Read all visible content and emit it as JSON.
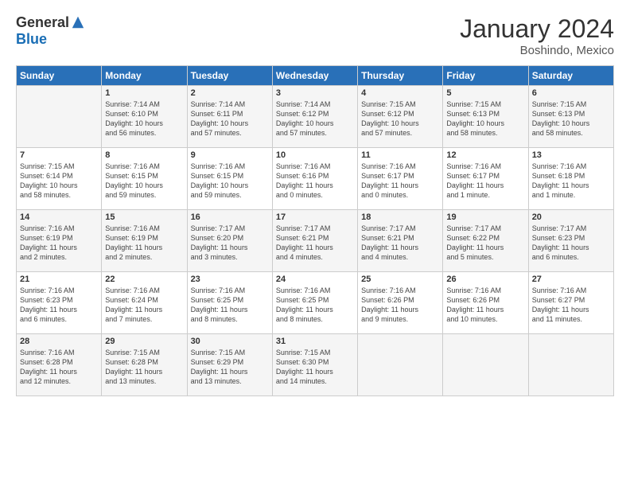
{
  "header": {
    "logo_general": "General",
    "logo_blue": "Blue",
    "title": "January 2024",
    "location": "Boshindo, Mexico"
  },
  "days_of_week": [
    "Sunday",
    "Monday",
    "Tuesday",
    "Wednesday",
    "Thursday",
    "Friday",
    "Saturday"
  ],
  "weeks": [
    [
      {
        "day": "",
        "info": ""
      },
      {
        "day": "1",
        "info": "Sunrise: 7:14 AM\nSunset: 6:10 PM\nDaylight: 10 hours\nand 56 minutes."
      },
      {
        "day": "2",
        "info": "Sunrise: 7:14 AM\nSunset: 6:11 PM\nDaylight: 10 hours\nand 57 minutes."
      },
      {
        "day": "3",
        "info": "Sunrise: 7:14 AM\nSunset: 6:12 PM\nDaylight: 10 hours\nand 57 minutes."
      },
      {
        "day": "4",
        "info": "Sunrise: 7:15 AM\nSunset: 6:12 PM\nDaylight: 10 hours\nand 57 minutes."
      },
      {
        "day": "5",
        "info": "Sunrise: 7:15 AM\nSunset: 6:13 PM\nDaylight: 10 hours\nand 58 minutes."
      },
      {
        "day": "6",
        "info": "Sunrise: 7:15 AM\nSunset: 6:13 PM\nDaylight: 10 hours\nand 58 minutes."
      }
    ],
    [
      {
        "day": "7",
        "info": "Sunrise: 7:15 AM\nSunset: 6:14 PM\nDaylight: 10 hours\nand 58 minutes."
      },
      {
        "day": "8",
        "info": "Sunrise: 7:16 AM\nSunset: 6:15 PM\nDaylight: 10 hours\nand 59 minutes."
      },
      {
        "day": "9",
        "info": "Sunrise: 7:16 AM\nSunset: 6:15 PM\nDaylight: 10 hours\nand 59 minutes."
      },
      {
        "day": "10",
        "info": "Sunrise: 7:16 AM\nSunset: 6:16 PM\nDaylight: 11 hours\nand 0 minutes."
      },
      {
        "day": "11",
        "info": "Sunrise: 7:16 AM\nSunset: 6:17 PM\nDaylight: 11 hours\nand 0 minutes."
      },
      {
        "day": "12",
        "info": "Sunrise: 7:16 AM\nSunset: 6:17 PM\nDaylight: 11 hours\nand 1 minute."
      },
      {
        "day": "13",
        "info": "Sunrise: 7:16 AM\nSunset: 6:18 PM\nDaylight: 11 hours\nand 1 minute."
      }
    ],
    [
      {
        "day": "14",
        "info": "Sunrise: 7:16 AM\nSunset: 6:19 PM\nDaylight: 11 hours\nand 2 minutes."
      },
      {
        "day": "15",
        "info": "Sunrise: 7:16 AM\nSunset: 6:19 PM\nDaylight: 11 hours\nand 2 minutes."
      },
      {
        "day": "16",
        "info": "Sunrise: 7:17 AM\nSunset: 6:20 PM\nDaylight: 11 hours\nand 3 minutes."
      },
      {
        "day": "17",
        "info": "Sunrise: 7:17 AM\nSunset: 6:21 PM\nDaylight: 11 hours\nand 4 minutes."
      },
      {
        "day": "18",
        "info": "Sunrise: 7:17 AM\nSunset: 6:21 PM\nDaylight: 11 hours\nand 4 minutes."
      },
      {
        "day": "19",
        "info": "Sunrise: 7:17 AM\nSunset: 6:22 PM\nDaylight: 11 hours\nand 5 minutes."
      },
      {
        "day": "20",
        "info": "Sunrise: 7:17 AM\nSunset: 6:23 PM\nDaylight: 11 hours\nand 6 minutes."
      }
    ],
    [
      {
        "day": "21",
        "info": "Sunrise: 7:16 AM\nSunset: 6:23 PM\nDaylight: 11 hours\nand 6 minutes."
      },
      {
        "day": "22",
        "info": "Sunrise: 7:16 AM\nSunset: 6:24 PM\nDaylight: 11 hours\nand 7 minutes."
      },
      {
        "day": "23",
        "info": "Sunrise: 7:16 AM\nSunset: 6:25 PM\nDaylight: 11 hours\nand 8 minutes."
      },
      {
        "day": "24",
        "info": "Sunrise: 7:16 AM\nSunset: 6:25 PM\nDaylight: 11 hours\nand 8 minutes."
      },
      {
        "day": "25",
        "info": "Sunrise: 7:16 AM\nSunset: 6:26 PM\nDaylight: 11 hours\nand 9 minutes."
      },
      {
        "day": "26",
        "info": "Sunrise: 7:16 AM\nSunset: 6:26 PM\nDaylight: 11 hours\nand 10 minutes."
      },
      {
        "day": "27",
        "info": "Sunrise: 7:16 AM\nSunset: 6:27 PM\nDaylight: 11 hours\nand 11 minutes."
      }
    ],
    [
      {
        "day": "28",
        "info": "Sunrise: 7:16 AM\nSunset: 6:28 PM\nDaylight: 11 hours\nand 12 minutes."
      },
      {
        "day": "29",
        "info": "Sunrise: 7:15 AM\nSunset: 6:28 PM\nDaylight: 11 hours\nand 13 minutes."
      },
      {
        "day": "30",
        "info": "Sunrise: 7:15 AM\nSunset: 6:29 PM\nDaylight: 11 hours\nand 13 minutes."
      },
      {
        "day": "31",
        "info": "Sunrise: 7:15 AM\nSunset: 6:30 PM\nDaylight: 11 hours\nand 14 minutes."
      },
      {
        "day": "",
        "info": ""
      },
      {
        "day": "",
        "info": ""
      },
      {
        "day": "",
        "info": ""
      }
    ]
  ]
}
